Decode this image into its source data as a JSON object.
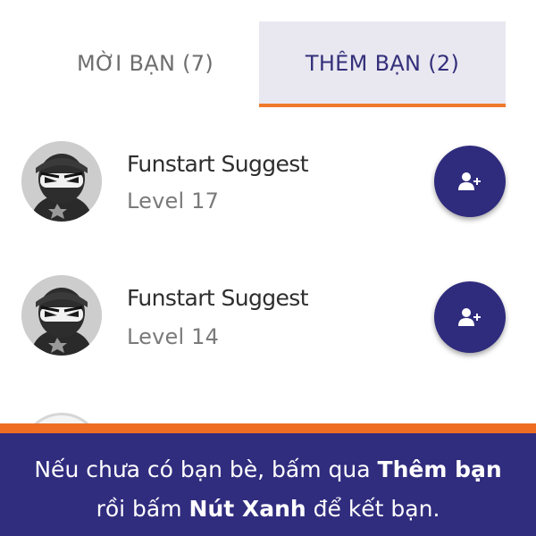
{
  "tabs": {
    "invite": "MỜI BẠN (7)",
    "add": "THÊM BẠN (2)"
  },
  "suggestions": [
    {
      "name": "Funstart Suggest",
      "level": "Level 17",
      "avatar_icon": "ninja-avatar-icon",
      "action_icon": "add-friend-icon"
    },
    {
      "name": "Funstart Suggest",
      "level": "Level 14",
      "avatar_icon": "ninja-avatar-icon",
      "action_icon": "add-friend-icon"
    }
  ],
  "banner": {
    "line1_prefix": "Nếu chưa có bạn bè, bấm qua ",
    "line1_bold": "Thêm bạn",
    "line2_prefix": "rồi bấm ",
    "line2_bold": "Nút Xanh",
    "line2_suffix": " để kết bạn."
  },
  "colors": {
    "accent_orange": "#ee7a2c",
    "primary_navy": "#2f2b7d",
    "active_tab_bg": "#e9e8f1"
  }
}
